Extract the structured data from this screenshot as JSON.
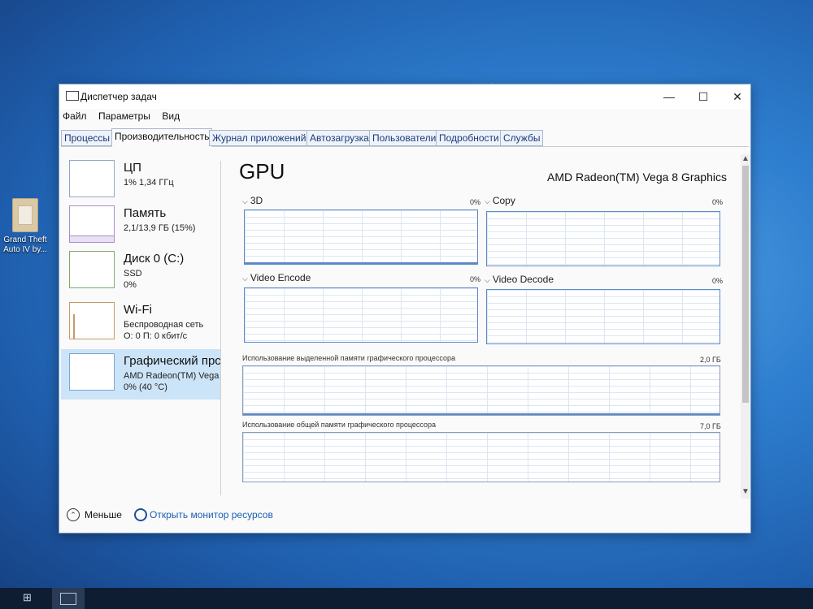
{
  "desktop": {
    "icon_label": "Grand Theft Auto IV by..."
  },
  "window": {
    "title": "Диспетчер задач",
    "controls": {
      "minimize": "—",
      "maximize": "☐",
      "close": "✕"
    }
  },
  "menu": [
    "Файл",
    "Параметры",
    "Вид"
  ],
  "tabs": [
    "Процессы",
    "Производительность",
    "Журнал приложений",
    "Автозагрузка",
    "Пользователи",
    "Подробности",
    "Службы"
  ],
  "active_tab": "Производительность",
  "sidebar": [
    {
      "name": "ЦП",
      "line1": "1% 1,34 ГГц",
      "line2": ""
    },
    {
      "name": "Память",
      "line1": "2,1/13,9 ГБ (15%)",
      "line2": ""
    },
    {
      "name": "Диск 0 (C:)",
      "line1": "SSD",
      "line2": "0%"
    },
    {
      "name": "Wi-Fi",
      "line1": "Беспроводная сеть",
      "line2": "О: 0 П: 0 кбит/с"
    },
    {
      "name": "Графический прс",
      "line1": "AMD Radeon(TM) Vega",
      "line2": "0% (40 °C)"
    }
  ],
  "selected_sidebar_index": 4,
  "main": {
    "title": "GPU",
    "model": "AMD Radeon(TM) Vega 8 Graphics",
    "engines": [
      {
        "label": "3D",
        "value": "0%"
      },
      {
        "label": "Copy",
        "value": "0%"
      },
      {
        "label": "Video Encode",
        "value": "0%"
      },
      {
        "label": "Video Decode",
        "value": "0%"
      }
    ],
    "dedicated_memory": {
      "label": "Использование выделенной памяти графического процессора",
      "max": "2,0 ГБ"
    },
    "shared_memory": {
      "label": "Использование общей памяти графического процессора",
      "max": "7,0 ГБ"
    }
  },
  "footer": {
    "less_label": "Меньше",
    "monitor_link": "Открыть монитор ресурсов"
  },
  "colors": {
    "accent": "#1a5fb4",
    "selection": "#cce4f7",
    "graph_border": "#5c8ac8"
  }
}
